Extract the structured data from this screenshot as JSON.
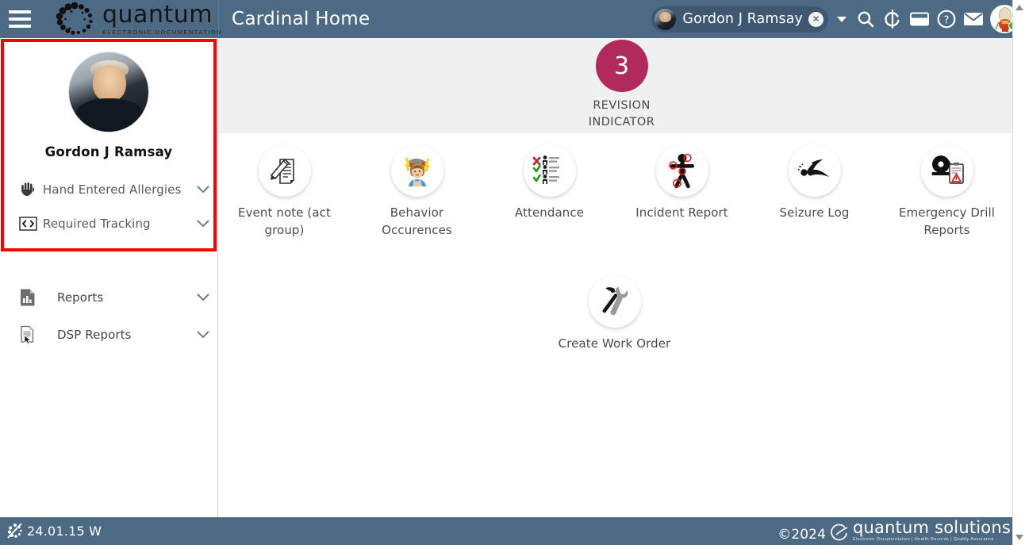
{
  "header": {
    "menu_icon": "hamburger-menu-icon",
    "brand_name": "quantum",
    "brand_tagline": "ELECTRONIC DOCUMENTATION",
    "page_title": "Cardinal Home",
    "patient_chip": {
      "name": "Gordon J Ramsay",
      "close_label": "✕",
      "avatar": "patient-avatar"
    },
    "icons": [
      {
        "name": "dropdown-caret-icon",
        "label": ""
      },
      {
        "name": "search-icon",
        "label": ""
      },
      {
        "name": "refresh-icon",
        "label": ""
      },
      {
        "name": "window-icon",
        "label": ""
      },
      {
        "name": "help-icon",
        "label": ""
      },
      {
        "name": "mail-icon",
        "label": ""
      }
    ],
    "user_avatar": "user-avatar",
    "user_status": "online"
  },
  "sidebar": {
    "patient_name": "Gordon J Ramsay",
    "patient_photo": "patient-photo",
    "items": [
      {
        "label": "Hand Entered Allergies",
        "icon": "hand-icon",
        "chevron": "chevron-down-icon"
      },
      {
        "label": "Required Tracking",
        "icon": "code-brackets-icon",
        "chevron": "chevron-down-icon"
      }
    ],
    "report_items": [
      {
        "label": "Reports",
        "icon": "bar-chart-document-icon",
        "chevron": "chevron-down-icon"
      },
      {
        "label": "DSP Reports",
        "icon": "document-cursor-icon",
        "chevron": "chevron-down-icon"
      }
    ]
  },
  "main": {
    "revision": {
      "count": "3",
      "line1": "REVISION",
      "line2": "INDICATOR"
    },
    "tiles_row1": [
      {
        "label": "Event note (act group)",
        "icon": "pencil-document-icon"
      },
      {
        "label": "Behavior Occurences",
        "icon": "person-stress-icon"
      },
      {
        "label": "Attendance",
        "icon": "attendance-checklist-icon"
      },
      {
        "label": "Incident Report",
        "icon": "injury-body-icon"
      },
      {
        "label": "Seizure Log",
        "icon": "seizure-wave-icon"
      },
      {
        "label": "Emergency Drill Reports",
        "icon": "alarm-clipboard-icon"
      }
    ],
    "tiles_row2": [
      {
        "label": "Create Work Order",
        "icon": "hammer-wrench-icon"
      }
    ]
  },
  "footer": {
    "version": "24.01.15 W",
    "version_icon": "quantum-small-icon",
    "copyright": "©2024",
    "brand_name": "quantum solutions",
    "brand_tagline": "Electronic Documentation  |  Health Records  |  Quality Assurance"
  },
  "colors": {
    "header_bg": "#4d6a85",
    "accent_badge": "#b22a5b",
    "highlight_border": "#fb0000",
    "banner_bg": "#f0f0f0",
    "status_online": "#2fbf2f"
  }
}
